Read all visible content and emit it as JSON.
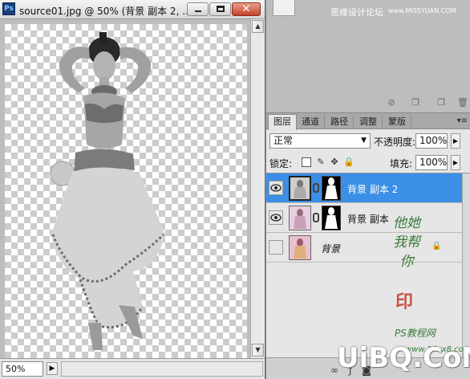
{
  "document": {
    "app_icon": "Ps",
    "title": "source01.jpg @ 50% (背景 副本 2, ...",
    "zoom": "50%"
  },
  "upper_panel": {
    "watermark": "思缘设计论坛",
    "watermark_url": "www.MISSYUAN.COM"
  },
  "layers_panel": {
    "tabs": [
      {
        "label": "图层",
        "active": true
      },
      {
        "label": "通道",
        "active": false
      },
      {
        "label": "路径",
        "active": false
      },
      {
        "label": "调整",
        "active": false
      },
      {
        "label": "蒙版",
        "active": false
      }
    ],
    "blend_mode": "正常",
    "opacity_label": "不透明度:",
    "opacity_value": "100%",
    "lock_label": "锁定:",
    "fill_label": "填充:",
    "fill_value": "100%",
    "layers": [
      {
        "name": "背景 副本 2",
        "visible": true,
        "selected": true,
        "has_mask": true
      },
      {
        "name": "背景 副本",
        "visible": true,
        "selected": false,
        "has_mask": true
      },
      {
        "name": "背景",
        "visible": false,
        "selected": false,
        "has_mask": false,
        "locked": true
      }
    ]
  },
  "watermarks": {
    "calligraphy": "他她我帮你",
    "site_line1": "PS教程网",
    "site_line2": "www.16xx8.com",
    "uibq": "UiBQ.CoM"
  },
  "icons": [
    "close-icon",
    "minimize-icon",
    "maximize-icon",
    "eye-icon",
    "link-icon",
    "lock-icon",
    "brush-icon",
    "move-icon",
    "dropdown-arrow-icon",
    "panel-menu-icon"
  ]
}
